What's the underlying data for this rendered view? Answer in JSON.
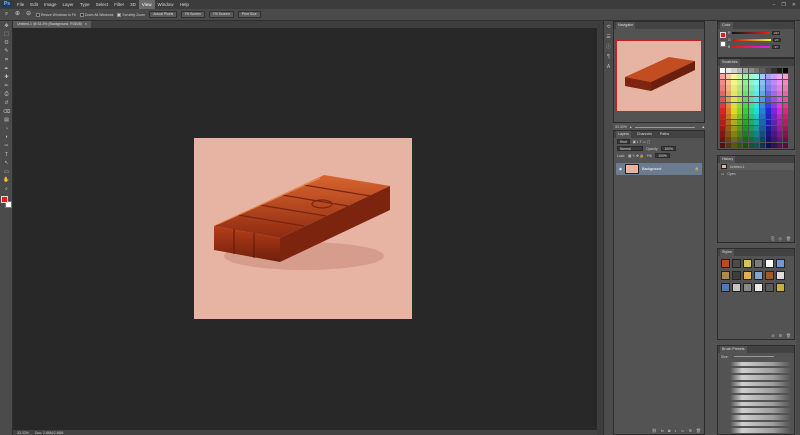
{
  "app": {
    "logo": "Ps"
  },
  "menubar": {
    "items": [
      "File",
      "Edit",
      "Image",
      "Layer",
      "Type",
      "Select",
      "Filter",
      "3D",
      "View",
      "Window",
      "Help"
    ],
    "active_index": 8
  },
  "window_controls": {
    "minimize": "–",
    "restore": "❐",
    "close": "✕"
  },
  "options_bar": {
    "zoom_icon": "zoom-icon",
    "checks": [
      {
        "label": "Resize Windows to Fit",
        "checked": false
      },
      {
        "label": "Zoom All Windows",
        "checked": false
      },
      {
        "label": "Scrubby Zoom",
        "checked": true
      }
    ],
    "buttons": [
      "Actual Pixels",
      "Fit Screen",
      "Fill Screen",
      "Print Size"
    ]
  },
  "document": {
    "tab_title": "Untitled-1 @ 33.3% (Background, RGB/8)",
    "close": "×",
    "colors": {
      "canvas_bg": "#282828",
      "image_bg": "#e7b4a3",
      "wood": "#b2401b"
    }
  },
  "status_bar": {
    "zoom": "33.33%",
    "doc_info": "Doc: 2.86M/2.86M"
  },
  "toolbar": {
    "tools": [
      "move-icon",
      "marquee-icon",
      "lasso-icon",
      "quick-select-icon",
      "crop-icon",
      "eyedropper-icon",
      "healing-icon",
      "brush-icon",
      "stamp-icon",
      "history-brush-icon",
      "eraser-icon",
      "gradient-icon",
      "blur-icon",
      "dodge-icon",
      "pen-icon",
      "type-icon",
      "path-select-icon",
      "shape-icon",
      "hand-icon",
      "zoom-icon"
    ],
    "foreground": "#e31b1b",
    "background": "#ffffff"
  },
  "navigator": {
    "tab": "Navigator",
    "zoom": "33.33%"
  },
  "layers": {
    "tabs": [
      "Layers",
      "Channels",
      "Paths"
    ],
    "kind_label": "Kind",
    "blend_mode": "Normal",
    "opacity_label": "Opacity:",
    "opacity": "100%",
    "lock_label": "Lock:",
    "fill_label": "Fill:",
    "fill": "100%",
    "layer_name": "Background"
  },
  "color": {
    "tab": "Color",
    "channels": [
      {
        "label": "R",
        "value": "227"
      },
      {
        "label": "G",
        "value": "27"
      },
      {
        "label": "B",
        "value": "27"
      }
    ]
  },
  "swatches": {
    "tab": "Swatches"
  },
  "history": {
    "tab": "History",
    "item": "Untitled-1",
    "snapshot": "Open"
  },
  "styles": {
    "tab": "Styles"
  },
  "brush_presets": {
    "tab": "Brush Presets",
    "size_label": "Size:"
  }
}
